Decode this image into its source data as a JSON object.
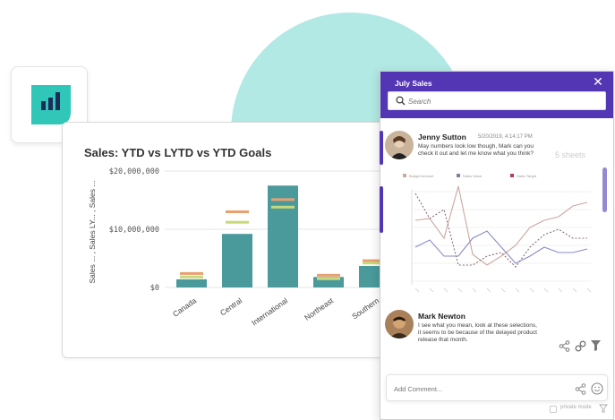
{
  "panel": {
    "title": "July Sales",
    "search_placeholder": "Search",
    "comment_placeholder": "Add Comment...",
    "private_label": "private mode",
    "sheet_label": "5 sheets"
  },
  "comments": [
    {
      "name": "Jenny Sutton",
      "timestamp": "5/20/2019, 4:14:17 PM",
      "text": [
        "May numbers look low though, Mark can you",
        "check it out and let me know what you think?"
      ]
    },
    {
      "name": "Mark Newton",
      "text": [
        "I see what you mean, look at these selections,",
        "it seems to be because of the delayed product",
        "release that month."
      ]
    }
  ],
  "mini_chart_legend": [
    "Budget Amount",
    "Sales Value",
    "Sales Target"
  ],
  "colors": {
    "header": "#5236b4",
    "blob": "#b3e9e4",
    "bar": "#4a9a9c",
    "goal_orange": "#e8a070",
    "goal_green": "#c8d87a"
  },
  "chart_data": {
    "type": "bar",
    "title": "Sales: YTD vs LYTD vs YTD Goals",
    "ylabel": "Sales ... , Sales LY... , Sales ...",
    "categories": [
      "Canada",
      "Central",
      "International",
      "Northeast",
      "Southern"
    ],
    "y_ticks": [
      "$0",
      "$10,000,000",
      "$20,000,000"
    ],
    "ylim": [
      0,
      20000000
    ],
    "series": [
      {
        "name": "Sales",
        "values": [
          1400000,
          9200000,
          17500000,
          1800000,
          3700000
        ]
      },
      {
        "name": "Sales LY",
        "values": [
          2400000,
          13000000,
          15100000,
          2100000,
          4600000
        ]
      },
      {
        "name": "Sales Goal",
        "values": [
          1800000,
          11200000,
          13800000,
          1500000,
          4200000
        ]
      }
    ]
  }
}
